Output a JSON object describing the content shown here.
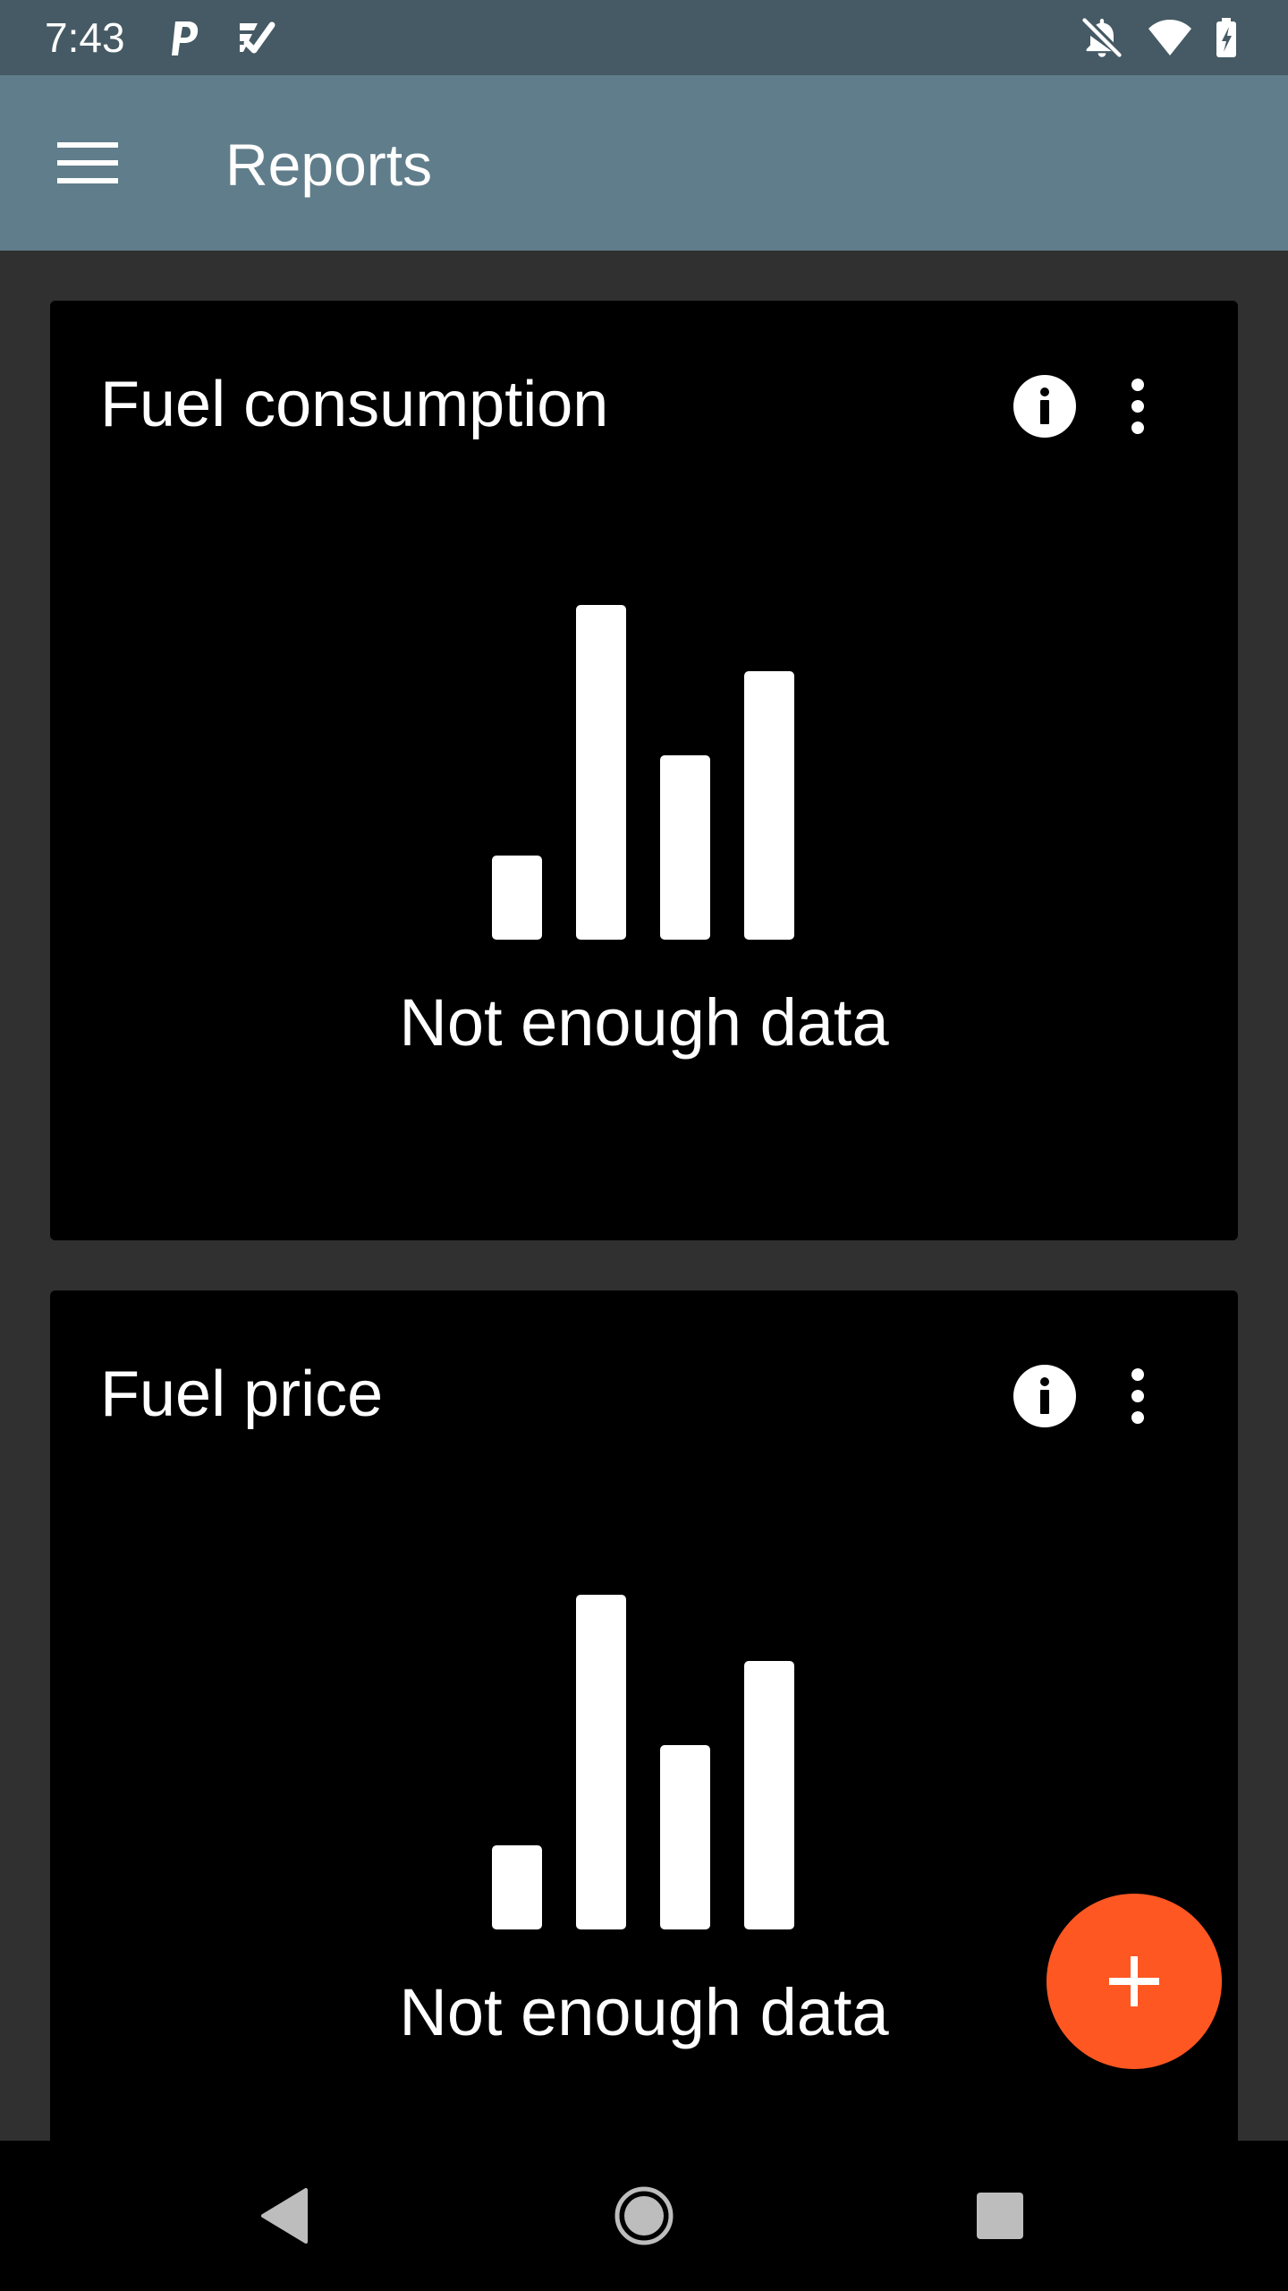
{
  "status_bar": {
    "time": "7:43",
    "left_icons": [
      "p-icon",
      "check-list-icon"
    ],
    "right_icons": [
      "notifications-off-icon",
      "wifi-icon",
      "battery-icon"
    ]
  },
  "app_bar": {
    "title": "Reports",
    "menu_icon": "menu-icon",
    "color": "#607d8b"
  },
  "cards": [
    {
      "title": "Fuel consumption",
      "empty_text": "Not enough data",
      "icons": [
        "info-icon",
        "more-vert-icon",
        "bar-chart-icon"
      ]
    },
    {
      "title": "Fuel price",
      "empty_text": "Not enough data",
      "icons": [
        "info-icon",
        "more-vert-icon",
        "bar-chart-icon"
      ]
    }
  ],
  "fab": {
    "icon": "add-icon",
    "color": "#ff5722"
  },
  "nav_bar": {
    "icons": [
      "back-icon",
      "home-icon",
      "recents-icon"
    ]
  }
}
